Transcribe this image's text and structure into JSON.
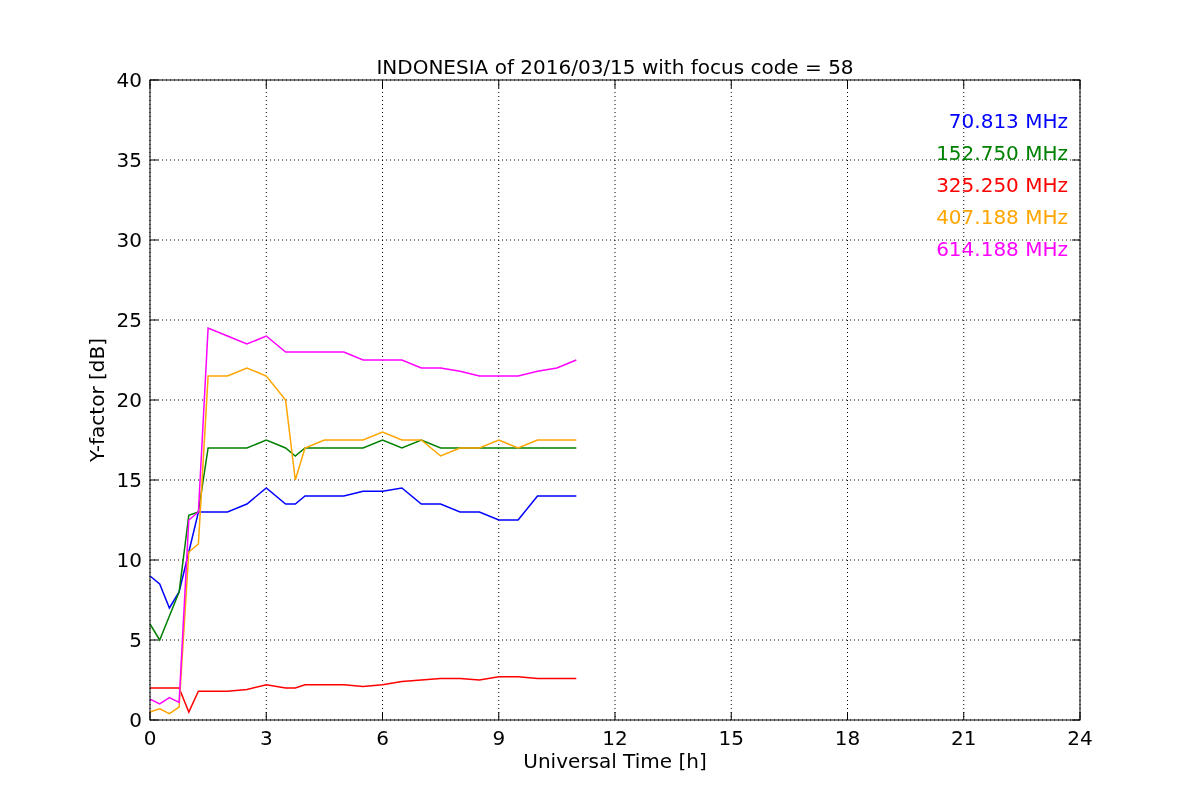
{
  "chart_data": {
    "type": "line",
    "title": "INDONESIA of 2016/03/15 with focus code = 58",
    "xlabel": "Universal Time [h]",
    "ylabel": "Y-factor [dB]",
    "x": [
      0,
      0.25,
      0.5,
      0.75,
      1.0,
      1.25,
      1.5,
      2,
      2.5,
      3,
      3.5,
      3.75,
      4,
      4.5,
      5,
      5.5,
      6,
      6.5,
      7,
      7.5,
      8,
      8.5,
      9,
      9.5,
      10,
      10.5,
      11
    ],
    "series": [
      {
        "name": "70.813 MHz",
        "color": "#0000ff",
        "values": [
          9,
          8.5,
          7,
          8,
          10.5,
          13,
          13,
          13,
          13.5,
          14.5,
          13.5,
          13.5,
          14,
          14,
          14,
          14.3,
          14.3,
          14.5,
          13.5,
          13.5,
          13,
          13,
          12.5,
          12.5,
          14,
          14,
          14
        ]
      },
      {
        "name": "152.750 MHz",
        "color": "#008000",
        "values": [
          6,
          5,
          6.5,
          8,
          12.8,
          13,
          17,
          17,
          17,
          17.5,
          17,
          16.5,
          17,
          17,
          17,
          17,
          17.5,
          17,
          17.5,
          17,
          17,
          17,
          17,
          17,
          17,
          17,
          17
        ]
      },
      {
        "name": "325.250 MHz",
        "color": "#ff0000",
        "values": [
          2,
          2,
          2,
          2,
          0.5,
          1.8,
          1.8,
          1.8,
          1.9,
          2.2,
          2,
          2,
          2.2,
          2.2,
          2.2,
          2.1,
          2.2,
          2.4,
          2.5,
          2.6,
          2.6,
          2.5,
          2.7,
          2.7,
          2.6,
          2.6,
          2.6
        ]
      },
      {
        "name": "407.188 MHz",
        "color": "#ffa500",
        "values": [
          0.5,
          0.7,
          0.4,
          0.8,
          10.5,
          11,
          21.5,
          21.5,
          22,
          21.5,
          20,
          15,
          17,
          17.5,
          17.5,
          17.5,
          18,
          17.5,
          17.5,
          16.5,
          17,
          17,
          17.5,
          17,
          17.5,
          17.5,
          17.5
        ]
      },
      {
        "name": "614.188 MHz",
        "color": "#ff00ff",
        "values": [
          1.3,
          1.0,
          1.4,
          1.1,
          12.5,
          13,
          24.5,
          24,
          23.5,
          24,
          23,
          23,
          23,
          23,
          23,
          22.5,
          22.5,
          22.5,
          22,
          22,
          21.8,
          21.5,
          21.5,
          21.5,
          21.8,
          22,
          22.5
        ]
      }
    ],
    "grid": true,
    "xlim": [
      0,
      24
    ],
    "ylim": [
      0,
      40
    ],
    "xticks": [
      0,
      3,
      6,
      9,
      12,
      15,
      18,
      21,
      24
    ],
    "yticks": [
      0,
      5,
      10,
      15,
      20,
      25,
      30,
      35,
      40
    ]
  }
}
